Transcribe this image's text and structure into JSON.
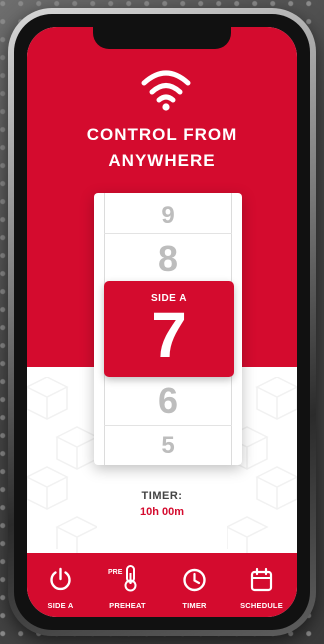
{
  "headline": {
    "line1": "CONTROL FROM",
    "line2": "ANYWHERE"
  },
  "picker": {
    "above": [
      "9",
      "8"
    ],
    "selected_label": "SIDE A",
    "selected_value": "7",
    "below": [
      "6",
      "5"
    ]
  },
  "timer": {
    "label": "TIMER:",
    "value": "10h 00m"
  },
  "tabs": [
    {
      "label": "SIDE A",
      "icon": "power-icon"
    },
    {
      "label": "PREHEAT",
      "icon": "thermometer-icon",
      "prefix": "PRE"
    },
    {
      "label": "TIMER",
      "icon": "clock-icon"
    },
    {
      "label": "SCHEDULE",
      "icon": "calendar-icon"
    }
  ],
  "colors": {
    "brand_red": "#d40b2e",
    "white": "#ffffff",
    "muted_number": "#bdbdbd"
  }
}
